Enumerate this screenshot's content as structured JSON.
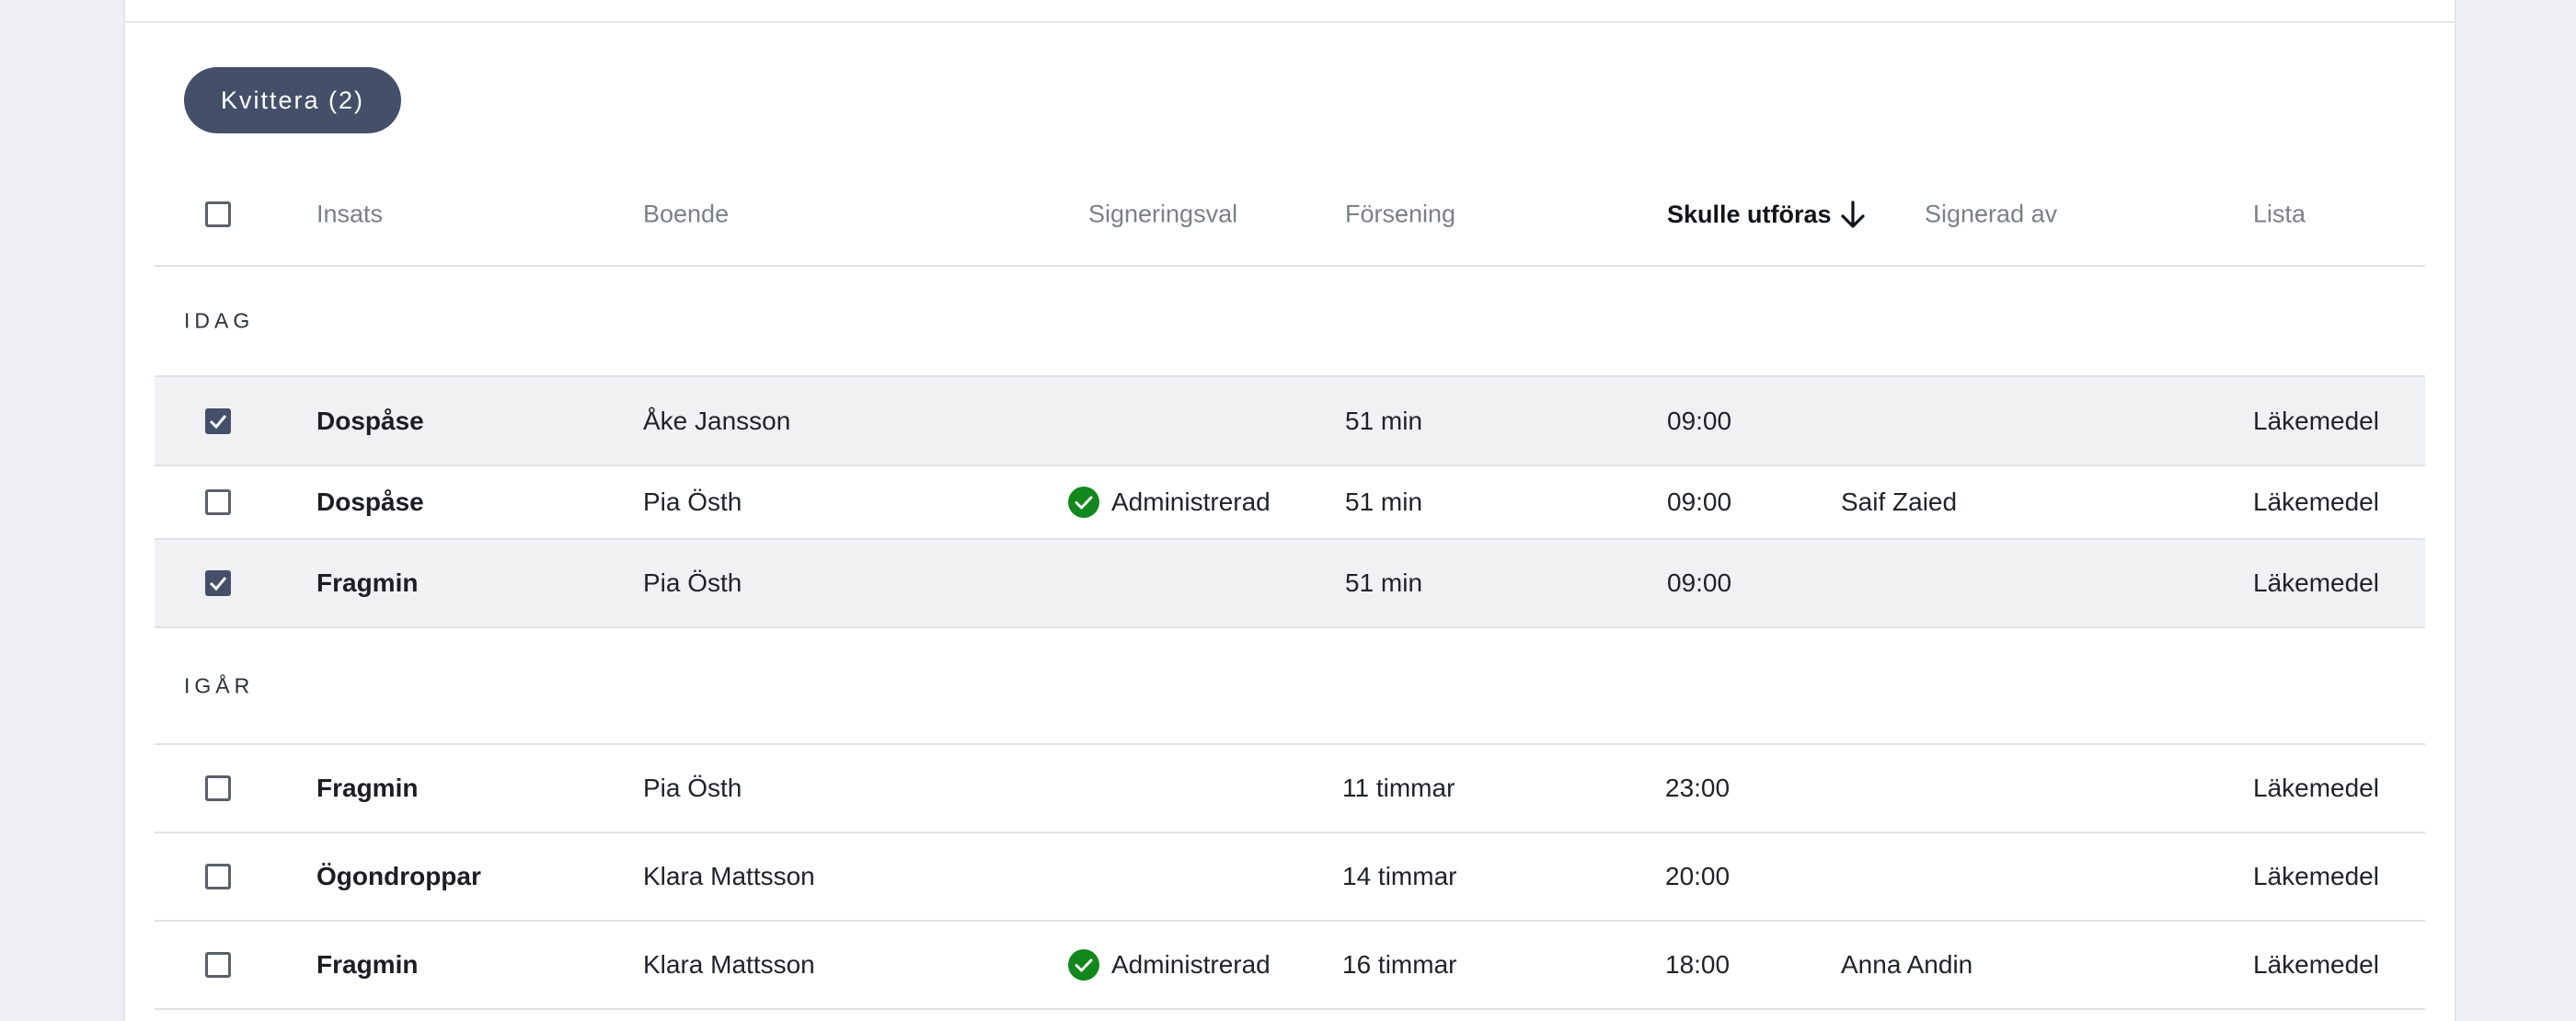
{
  "actions": {
    "acknowledge_button": "Kvittera (2)"
  },
  "columns": {
    "insats": "Insats",
    "boende": "Boende",
    "signeringsval": "Signeringsval",
    "forsening": "Försening",
    "skulle_utforas": "Skulle utföras",
    "signerad_av": "Signerad av",
    "lista": "Lista"
  },
  "sort": {
    "column": "skulle_utforas",
    "direction": "descending",
    "icon": "arrow-down-icon"
  },
  "colors": {
    "accent": "#44506a",
    "success": "#12871c",
    "selected_row": "#f0f1f3"
  },
  "groups": [
    {
      "label": "IDAG",
      "rows": [
        {
          "checked": true,
          "insats": "Dospåse",
          "boende": "Åke Jansson",
          "signeringsval": "",
          "forsening": "51 min",
          "skulle_utforas": "09:00",
          "signerad_av": "",
          "lista": "Läkemedel"
        },
        {
          "checked": false,
          "insats": "Dospåse",
          "boende": "Pia Östh",
          "signeringsval": "Administrerad",
          "forsening": "51 min",
          "skulle_utforas": "09:00",
          "signerad_av": "Saif Zaied",
          "lista": "Läkemedel"
        },
        {
          "checked": true,
          "insats": "Fragmin",
          "boende": "Pia Östh",
          "signeringsval": "",
          "forsening": "51 min",
          "skulle_utforas": "09:00",
          "signerad_av": "",
          "lista": "Läkemedel"
        }
      ]
    },
    {
      "label": "IGÅR",
      "rows": [
        {
          "checked": false,
          "insats": "Fragmin",
          "boende": "Pia Östh",
          "signeringsval": "",
          "forsening": "11 timmar",
          "skulle_utforas": "23:00",
          "signerad_av": "",
          "lista": "Läkemedel"
        },
        {
          "checked": false,
          "insats": "Ögondroppar",
          "boende": "Klara Mattsson",
          "signeringsval": "",
          "forsening": "14 timmar",
          "skulle_utforas": "20:00",
          "signerad_av": "",
          "lista": "Läkemedel"
        },
        {
          "checked": false,
          "insats": "Fragmin",
          "boende": "Klara Mattsson",
          "signeringsval": "Administrerad",
          "forsening": "16 timmar",
          "skulle_utforas": "18:00",
          "signerad_av": "Anna Andin",
          "lista": "Läkemedel"
        }
      ]
    }
  ]
}
